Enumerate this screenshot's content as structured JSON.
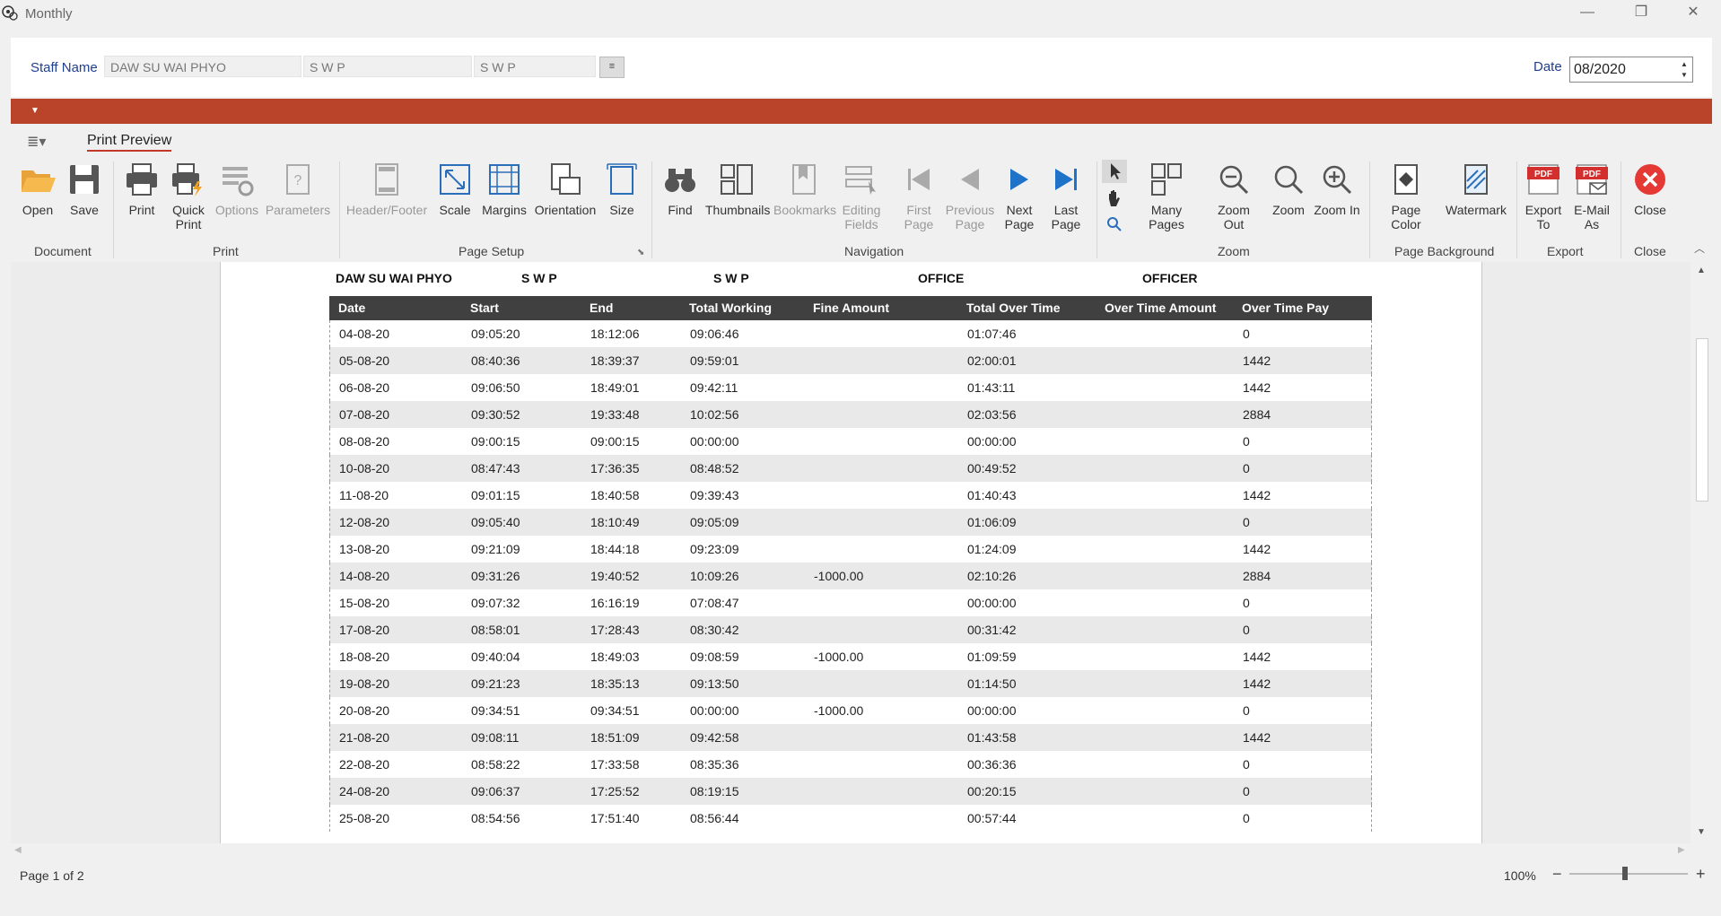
{
  "window": {
    "title": "Monthly",
    "minimize": "—",
    "maximize": "❐",
    "close": "✕"
  },
  "header": {
    "staff_label": "Staff Name",
    "staff_name": "DAW SU WAI PHYO",
    "code1": "S W P",
    "code2": "S W P",
    "lookup": "≡",
    "date_label": "Date",
    "date_value": "08/2020"
  },
  "ribbon": {
    "menu_icon": "≣▾",
    "tab": "Print Preview",
    "buttons": {
      "open": "Open",
      "save": "Save",
      "print": "Print",
      "quick_print": "Quick Print",
      "options": "Options",
      "parameters": "Parameters",
      "header_footer": "Header/Footer",
      "scale": "Scale",
      "margins": "Margins",
      "orientation": "Orientation",
      "size": "Size",
      "find": "Find",
      "thumbnails": "Thumbnails",
      "bookmarks": "Bookmarks",
      "editing_fields": "Editing Fields",
      "first_page": "First Page",
      "previous_page": "Previous Page",
      "next_page": "Next Page",
      "last_page": "Last Page",
      "many_pages": "Many Pages",
      "zoom_out": "Zoom Out",
      "zoom": "Zoom",
      "zoom_in": "Zoom In",
      "page_color": "Page Color",
      "watermark": "Watermark",
      "export_to": "Export To",
      "email_as": "E-Mail As",
      "close": "Close"
    },
    "groups": {
      "document": "Document",
      "print": "Print",
      "page_setup": "Page Setup",
      "navigation": "Navigation",
      "zoom": "Zoom",
      "page_background": "Page Background",
      "export": "Export",
      "close": "Close"
    }
  },
  "report": {
    "name": "DAW SU WAI PHYO",
    "code1": "S W P",
    "code2": "S W P",
    "department": "OFFICE",
    "position": "OFFICER",
    "columns": [
      "Date",
      "Start",
      "End",
      "Total Working",
      "Fine Amount",
      "Total Over Time",
      "Over Time Amount",
      "Over Time Pay"
    ],
    "rows": [
      [
        "04-08-20",
        "09:05:20",
        "18:12:06",
        "09:06:46",
        "",
        "01:07:46",
        "",
        "0"
      ],
      [
        "05-08-20",
        "08:40:36",
        "18:39:37",
        "09:59:01",
        "",
        "02:00:01",
        "",
        "1442"
      ],
      [
        "06-08-20",
        "09:06:50",
        "18:49:01",
        "09:42:11",
        "",
        "01:43:11",
        "",
        "1442"
      ],
      [
        "07-08-20",
        "09:30:52",
        "19:33:48",
        "10:02:56",
        "",
        "02:03:56",
        "",
        "2884"
      ],
      [
        "08-08-20",
        "09:00:15",
        "09:00:15",
        "00:00:00",
        "",
        "00:00:00",
        "",
        "0"
      ],
      [
        "10-08-20",
        "08:47:43",
        "17:36:35",
        "08:48:52",
        "",
        "00:49:52",
        "",
        "0"
      ],
      [
        "11-08-20",
        "09:01:15",
        "18:40:58",
        "09:39:43",
        "",
        "01:40:43",
        "",
        "1442"
      ],
      [
        "12-08-20",
        "09:05:40",
        "18:10:49",
        "09:05:09",
        "",
        "01:06:09",
        "",
        "0"
      ],
      [
        "13-08-20",
        "09:21:09",
        "18:44:18",
        "09:23:09",
        "",
        "01:24:09",
        "",
        "1442"
      ],
      [
        "14-08-20",
        "09:31:26",
        "19:40:52",
        "10:09:26",
        "-1000.00",
        "02:10:26",
        "",
        "2884"
      ],
      [
        "15-08-20",
        "09:07:32",
        "16:16:19",
        "07:08:47",
        "",
        "00:00:00",
        "",
        "0"
      ],
      [
        "17-08-20",
        "08:58:01",
        "17:28:43",
        "08:30:42",
        "",
        "00:31:42",
        "",
        "0"
      ],
      [
        "18-08-20",
        "09:40:04",
        "18:49:03",
        "09:08:59",
        "-1000.00",
        "01:09:59",
        "",
        "1442"
      ],
      [
        "19-08-20",
        "09:21:23",
        "18:35:13",
        "09:13:50",
        "",
        "01:14:50",
        "",
        "1442"
      ],
      [
        "20-08-20",
        "09:34:51",
        "09:34:51",
        "00:00:00",
        "-1000.00",
        "00:00:00",
        "",
        "0"
      ],
      [
        "21-08-20",
        "09:08:11",
        "18:51:09",
        "09:42:58",
        "",
        "01:43:58",
        "",
        "1442"
      ],
      [
        "22-08-20",
        "08:58:22",
        "17:33:58",
        "08:35:36",
        "",
        "00:36:36",
        "",
        "0"
      ],
      [
        "24-08-20",
        "09:06:37",
        "17:25:52",
        "08:19:15",
        "",
        "00:20:15",
        "",
        "0"
      ],
      [
        "25-08-20",
        "08:54:56",
        "17:51:40",
        "08:56:44",
        "",
        "00:57:44",
        "",
        "0"
      ]
    ]
  },
  "status": {
    "page_info": "Page 1 of 2",
    "zoom_level": "100%",
    "zoom_minus": "−",
    "zoom_plus": "+"
  },
  "colors": {
    "accent_bar": "#b94429",
    "table_header": "#404040",
    "label_blue": "#1f3f8f",
    "nav_blue": "#1e73c8",
    "close_red": "#e53935",
    "pdf_red": "#d32f2f"
  }
}
